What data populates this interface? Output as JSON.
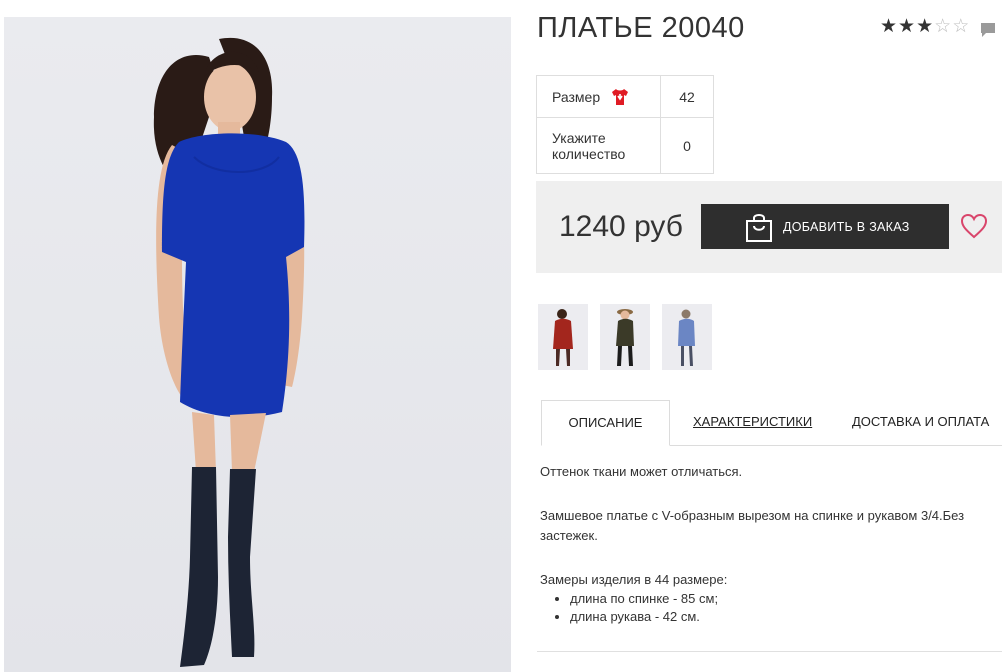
{
  "product": {
    "title": "ПЛАТЬЕ 20040",
    "rating": {
      "value": 3,
      "max": 5
    }
  },
  "options": {
    "size_label": "Размер",
    "size_value": "42",
    "qty_label": "Укажите количество",
    "qty_value": "0"
  },
  "buy": {
    "price": "1240 руб",
    "add_button": "ДОБАВИТЬ В ЗАКАЗ"
  },
  "thumbnails": [
    {
      "name": "thumbnail-red-dress",
      "dress_color": "#a3261d"
    },
    {
      "name": "thumbnail-olive-dress",
      "dress_color": "#3b3a28"
    },
    {
      "name": "thumbnail-blue-dress",
      "dress_color": "#6b86c4"
    }
  ],
  "tabs": [
    {
      "label": "ОПИСАНИЕ",
      "active": true
    },
    {
      "label": "ХАРАКТЕРИСТИКИ",
      "active": false
    },
    {
      "label": "ДОСТАВКА И ОПЛАТА",
      "active": false
    }
  ],
  "description": {
    "p1": "Оттенок ткани может отличаться.",
    "p2": "Замшевое платье с V-образным вырезом на спинке и рукавом 3/4.Без застежек.",
    "p3": "Замеры изделия в 44 размере:",
    "measurements": [
      "длина по спинке - 85 см;",
      "длина рукава - 42 см."
    ]
  },
  "colors": {
    "main_dress": "#1536b3",
    "button_bg": "#2e2e2e",
    "heart": "#d9456b",
    "size_icon": "#e01b24"
  },
  "icons": {
    "rating": "star-icon",
    "comment": "comment-icon",
    "size": "tshirt-icon",
    "bag": "shopping-bag-icon",
    "wishlist": "heart-icon"
  }
}
